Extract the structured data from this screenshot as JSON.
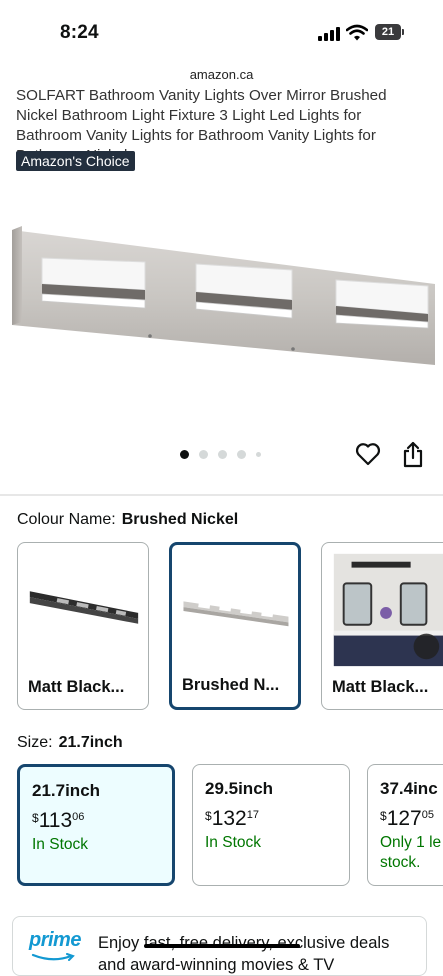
{
  "status_bar": {
    "time": "8:24",
    "battery_level": "21"
  },
  "browser": {
    "url": "amazon.ca"
  },
  "product": {
    "title": "SOLFART Bathroom Vanity Lights Over Mirror Brushed Nickel Bathroom Light Fixture 3 Light Led Lights for Bathroom Vanity Lights for Bathroom Vanity Lights for Bathroom Nickel",
    "badge": "Amazon's Choice",
    "image_icon": "vanity-light-fixture-image",
    "carousel": {
      "total_dots": 5,
      "active_index": 0
    }
  },
  "actions": {
    "wishlist_icon": "heart-icon",
    "share_icon": "share-icon"
  },
  "colour": {
    "label": "Colour Name:",
    "selected": "Brushed Nickel",
    "options": [
      {
        "label": "Matt Black...",
        "selected": false
      },
      {
        "label": "Brushed N...",
        "selected": true
      },
      {
        "label": "Matt Black...",
        "selected": false
      }
    ]
  },
  "size": {
    "label": "Size:",
    "selected": "21.7inch",
    "options": [
      {
        "name": "21.7inch",
        "currency": "$",
        "whole": "113",
        "fraction": "06",
        "stock": "In Stock",
        "selected": true
      },
      {
        "name": "29.5inch",
        "currency": "$",
        "whole": "132",
        "fraction": "17",
        "stock": "In Stock",
        "selected": false
      },
      {
        "name": "37.4inc",
        "currency": "$",
        "whole": "127",
        "fraction": "05",
        "stock": "Only 1 le stock.",
        "selected": false
      }
    ]
  },
  "prime": {
    "logo": "prime",
    "text": "Enjoy fast, free delivery, exclusive deals and award-winning movies & TV"
  },
  "colors": {
    "badge_bg": "#232f3e",
    "selected_border": "#16466e",
    "selected_bg": "#edfdff",
    "stock_green": "#007600",
    "prime_blue": "#1399d2"
  }
}
